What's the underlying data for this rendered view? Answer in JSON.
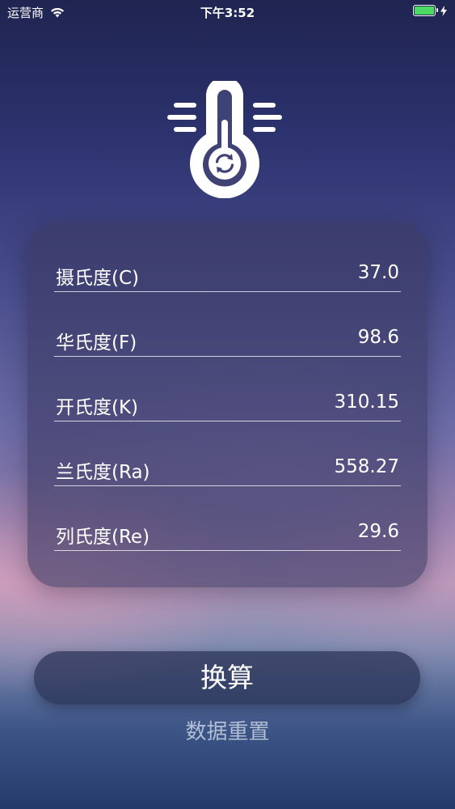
{
  "status_bar": {
    "carrier": "运营商",
    "time": "下午3:52",
    "battery_level": 1.0
  },
  "colors": {
    "battery": "#4cd964",
    "text": "#ffffff",
    "reset_text": "#d2dceb"
  },
  "icons": {
    "app_logo": "thermometer-conversion-icon",
    "wifi": "wifi-icon",
    "battery": "battery-icon",
    "charging": "charging-bolt-icon"
  },
  "temperatures": [
    {
      "label": "摄氏度(C)",
      "value": "37.0"
    },
    {
      "label": "华氏度(F)",
      "value": "98.6"
    },
    {
      "label": "开氏度(K)",
      "value": "310.15"
    },
    {
      "label": "兰氏度(Ra)",
      "value": "558.27"
    },
    {
      "label": "列氏度(Re)",
      "value": "29.6"
    }
  ],
  "actions": {
    "convert_label": "换算",
    "reset_label": "数据重置"
  }
}
